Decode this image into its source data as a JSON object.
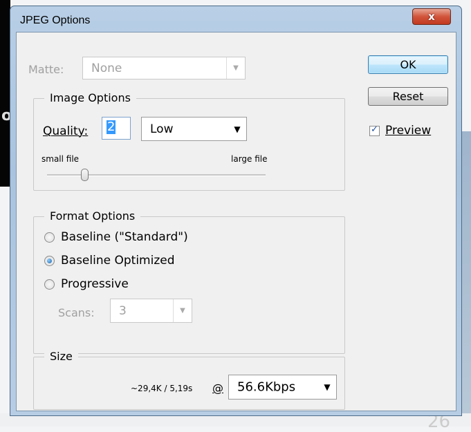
{
  "window": {
    "title": "JPEG Options",
    "close_glyph": "x"
  },
  "matte": {
    "label": "Matte:",
    "value": "None"
  },
  "image_options": {
    "legend": "Image Options",
    "quality_label": "Quality:",
    "quality_value": "2",
    "quality_preset": "Low",
    "slider_min_label": "small file",
    "slider_max_label": "large file",
    "slider_level_fraction": 0.17
  },
  "format_options": {
    "legend": "Format Options",
    "options": [
      {
        "label": "Baseline (\"Standard\")",
        "selected": false
      },
      {
        "label": "Baseline Optimized",
        "selected": true
      },
      {
        "label": "Progressive",
        "selected": false
      }
    ],
    "scans_label": "Scans:",
    "scans_value": "3"
  },
  "size": {
    "legend": "Size",
    "estimate": "~29,4K / 5,19s",
    "at_symbol": "@",
    "speed": "56.6Kbps"
  },
  "buttons": {
    "ok": "OK",
    "reset": "Reset"
  },
  "preview": {
    "label": "Preview",
    "checked": true
  },
  "colors": {
    "selection": "#3399ff",
    "default_button_border": "#3c7fb1",
    "close_red": "#c23a1f"
  },
  "icons": {
    "close": "close-icon",
    "dropdown": "chevron-down-icon"
  },
  "background": {
    "glyph": "o",
    "number": "26"
  }
}
